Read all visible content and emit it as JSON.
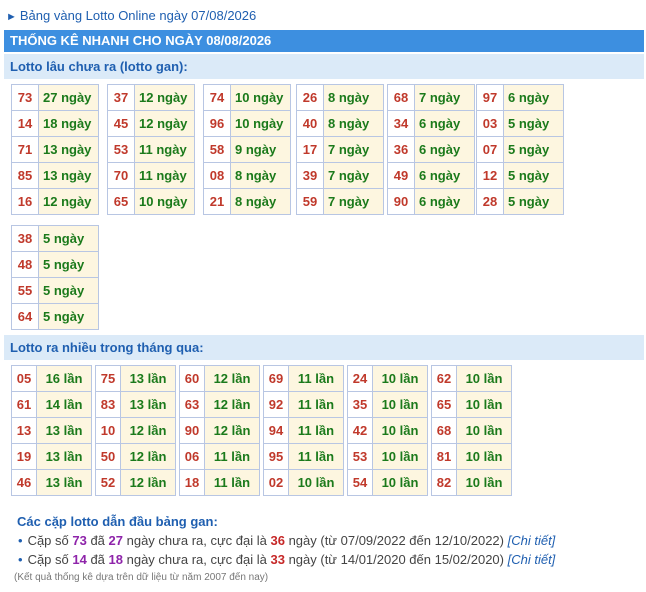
{
  "top_link": "Bảng vàng Lotto Online ngày 07/08/2026",
  "header_title": "THỐNG KÊ NHANH CHO NGÀY 08/08/2026",
  "gan_section": {
    "title": "Lotto lâu chưa ra (lotto gan):",
    "groups": [
      [
        {
          "n": "73",
          "v": "27 ngày"
        },
        {
          "n": "14",
          "v": "18 ngày"
        },
        {
          "n": "71",
          "v": "13 ngày"
        },
        {
          "n": "85",
          "v": "13 ngày"
        },
        {
          "n": "16",
          "v": "12 ngày"
        }
      ],
      [
        {
          "n": "37",
          "v": "12 ngày"
        },
        {
          "n": "45",
          "v": "12 ngày"
        },
        {
          "n": "53",
          "v": "11 ngày"
        },
        {
          "n": "70",
          "v": "11 ngày"
        },
        {
          "n": "65",
          "v": "10 ngày"
        }
      ],
      [
        {
          "n": "74",
          "v": "10 ngày"
        },
        {
          "n": "96",
          "v": "10 ngày"
        },
        {
          "n": "58",
          "v": "9 ngày"
        },
        {
          "n": "08",
          "v": "8 ngày"
        },
        {
          "n": "21",
          "v": "8 ngày"
        }
      ],
      [
        {
          "n": "26",
          "v": "8 ngày"
        },
        {
          "n": "40",
          "v": "8 ngày"
        },
        {
          "n": "17",
          "v": "7 ngày"
        },
        {
          "n": "39",
          "v": "7 ngày"
        },
        {
          "n": "59",
          "v": "7 ngày"
        }
      ],
      [
        {
          "n": "68",
          "v": "7 ngày"
        },
        {
          "n": "34",
          "v": "6 ngày"
        },
        {
          "n": "36",
          "v": "6 ngày"
        },
        {
          "n": "49",
          "v": "6 ngày"
        },
        {
          "n": "90",
          "v": "6 ngày"
        }
      ],
      [
        {
          "n": "97",
          "v": "6 ngày"
        },
        {
          "n": "03",
          "v": "5 ngày"
        },
        {
          "n": "07",
          "v": "5 ngày"
        },
        {
          "n": "12",
          "v": "5 ngày"
        },
        {
          "n": "28",
          "v": "5 ngày"
        }
      ],
      [
        {
          "n": "38",
          "v": "5 ngày"
        },
        {
          "n": "48",
          "v": "5 ngày"
        },
        {
          "n": "55",
          "v": "5 ngày"
        },
        {
          "n": "64",
          "v": "5 ngày"
        }
      ]
    ]
  },
  "freq_section": {
    "title": "Lotto ra nhiều trong tháng qua:",
    "groups": [
      [
        {
          "n": "05",
          "v": "16 lần"
        },
        {
          "n": "61",
          "v": "14 lần"
        },
        {
          "n": "13",
          "v": "13 lần"
        },
        {
          "n": "19",
          "v": "13 lần"
        },
        {
          "n": "46",
          "v": "13 lần"
        }
      ],
      [
        {
          "n": "75",
          "v": "13 lần"
        },
        {
          "n": "83",
          "v": "13 lần"
        },
        {
          "n": "10",
          "v": "12 lần"
        },
        {
          "n": "50",
          "v": "12 lần"
        },
        {
          "n": "52",
          "v": "12 lần"
        }
      ],
      [
        {
          "n": "60",
          "v": "12 lần"
        },
        {
          "n": "63",
          "v": "12 lần"
        },
        {
          "n": "90",
          "v": "12 lần"
        },
        {
          "n": "06",
          "v": "11 lần"
        },
        {
          "n": "18",
          "v": "11 lần"
        }
      ],
      [
        {
          "n": "69",
          "v": "11 lần"
        },
        {
          "n": "92",
          "v": "11 lần"
        },
        {
          "n": "94",
          "v": "11 lần"
        },
        {
          "n": "95",
          "v": "11 lần"
        },
        {
          "n": "02",
          "v": "10 lần"
        }
      ],
      [
        {
          "n": "24",
          "v": "10 lần"
        },
        {
          "n": "35",
          "v": "10 lần"
        },
        {
          "n": "42",
          "v": "10 lần"
        },
        {
          "n": "53",
          "v": "10 lần"
        },
        {
          "n": "54",
          "v": "10 lần"
        }
      ],
      [
        {
          "n": "62",
          "v": "10 lần"
        },
        {
          "n": "65",
          "v": "10 lần"
        },
        {
          "n": "68",
          "v": "10 lần"
        },
        {
          "n": "81",
          "v": "10 lần"
        },
        {
          "n": "82",
          "v": "10 lần"
        }
      ]
    ]
  },
  "pairs": {
    "title": "Các cặp lotto dẫn đầu bảng gan:",
    "items": [
      {
        "p1": "Cặp số ",
        "num": "73",
        "p2": " đã ",
        "days": "27",
        "p3": " ngày chưa ra, cực đại là ",
        "max": "36",
        "p4": " ngày (từ 07/09/2022 đến 12/10/2022) ",
        "link": "[Chi tiết]"
      },
      {
        "p1": "Cặp số ",
        "num": "14",
        "p2": " đã ",
        "days": "18",
        "p3": " ngày chưa ra, cực đại là ",
        "max": "33",
        "p4": " ngày (từ 14/01/2020 đến 15/02/2020) ",
        "link": "[Chi tiết]"
      }
    ]
  },
  "note": "(Kết quả thống kê dựa trên dữ liệu từ năm 2007 đến nay)"
}
